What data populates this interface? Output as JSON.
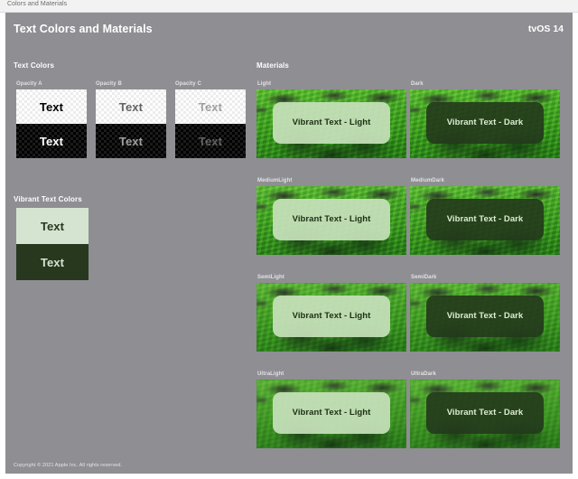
{
  "window": {
    "title": "Colors and Materials"
  },
  "header": {
    "title": "Text Colors and Materials",
    "platform_badge": "tvOS 14"
  },
  "colors": {
    "canvas_bg": "#8e8e93",
    "titlebar_bg": "#f2f2f2",
    "vibrant_light_bg": "#d4e4d0",
    "vibrant_light_text": "#27381f",
    "vibrant_dark_bg": "#27381f",
    "vibrant_dark_text": "#d4e4d0",
    "overlay_light_bg": "#c6e0ba",
    "overlay_light_text": "#1d2e16",
    "overlay_dark_bg": "#24381c",
    "overlay_dark_text": "#dcecd2",
    "label_text": "#e3e3e6",
    "heading_text": "#ffffff"
  },
  "text_colors": {
    "section_title": "Text Colors",
    "groups": [
      {
        "label": "Opacity A",
        "sample_text": "Text",
        "on_light_opacity": "1.0",
        "on_dark_opacity": "1.0"
      },
      {
        "label": "Opacity B",
        "sample_text": "Text",
        "on_light_opacity": "0.6",
        "on_dark_opacity": "0.6"
      },
      {
        "label": "Opacity C",
        "sample_text": "Text",
        "on_light_opacity": "0.35",
        "on_dark_opacity": "0.35"
      }
    ]
  },
  "vibrant_text_colors": {
    "section_title": "Vibrant Text Colors",
    "swatches": [
      {
        "sample_text": "Text",
        "variant": "light"
      },
      {
        "sample_text": "Text",
        "variant": "dark"
      }
    ]
  },
  "materials": {
    "section_title": "Materials",
    "cards": [
      {
        "label": "Light",
        "overlay_text": "Vibrant Text - Light",
        "variant": "light",
        "blur_class": "mat-light"
      },
      {
        "label": "Dark",
        "overlay_text": "Vibrant Text - Dark",
        "variant": "dark",
        "blur_class": "mat-light"
      },
      {
        "label": "MediumLight",
        "overlay_text": "Vibrant Text - Light",
        "variant": "light",
        "blur_class": "mat-mediumlight"
      },
      {
        "label": "MediumDark",
        "overlay_text": "Vibrant Text - Dark",
        "variant": "dark",
        "blur_class": "mat-mediumlight"
      },
      {
        "label": "SemiLight",
        "overlay_text": "Vibrant Text - Light",
        "variant": "light",
        "blur_class": "mat-semilight"
      },
      {
        "label": "SemiDark",
        "overlay_text": "Vibrant Text - Dark",
        "variant": "dark",
        "blur_class": "mat-semilight"
      },
      {
        "label": "UltraLight",
        "overlay_text": "Vibrant Text - Light",
        "variant": "light",
        "blur_class": "mat-ultralight"
      },
      {
        "label": "UltraDark",
        "overlay_text": "Vibrant Text - Dark",
        "variant": "dark",
        "blur_class": "mat-ultralight"
      }
    ]
  },
  "footer": {
    "copyright": "Copyright © 2021 Apple Inc. All rights reserved."
  }
}
